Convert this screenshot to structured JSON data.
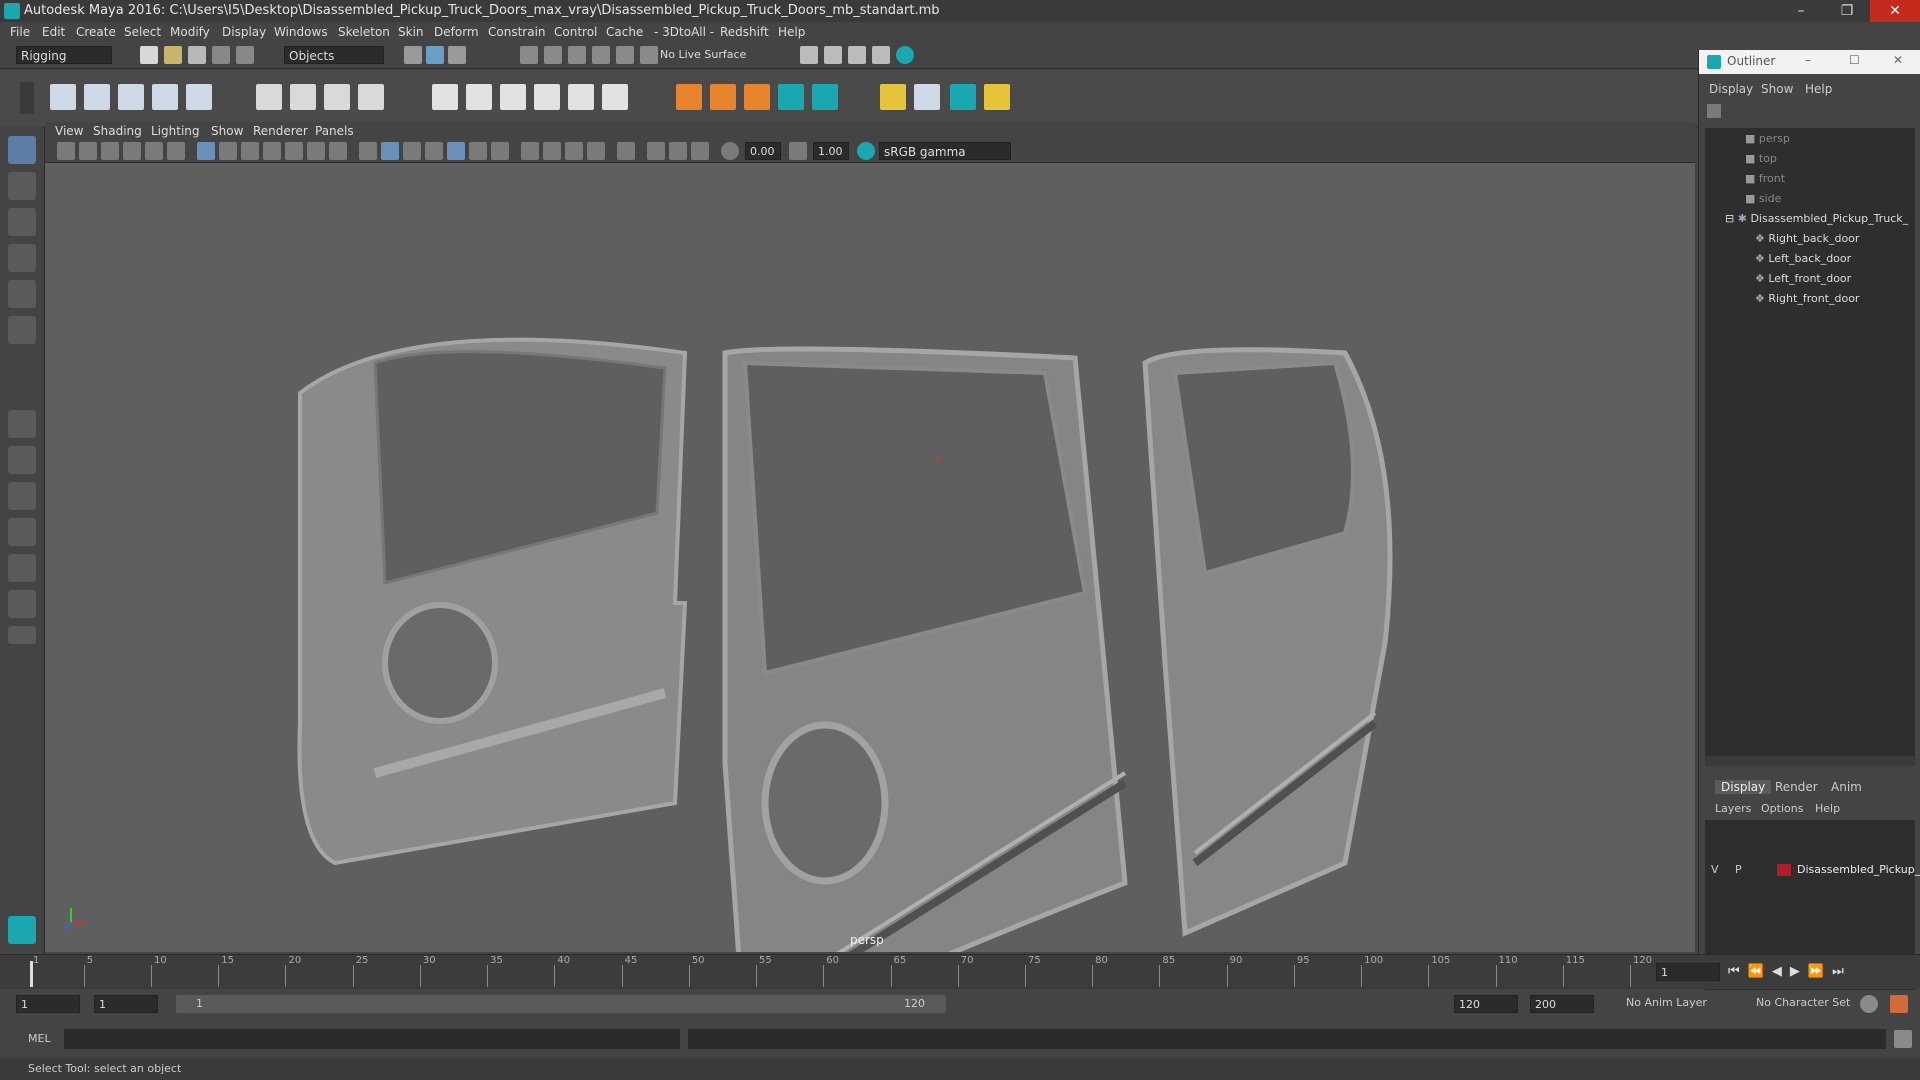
{
  "window": {
    "title": "Autodesk Maya 2016: C:\\Users\\I5\\Desktop\\Disassembled_Pickup_Truck_Doors_max_vray\\Disassembled_Pickup_Truck_Doors_mb_standart.mb",
    "min": "–",
    "restore": "❐",
    "close": "✕"
  },
  "menubar": [
    "File",
    "Edit",
    "Create",
    "Select",
    "Modify",
    "Display",
    "Windows",
    "Skeleton",
    "Skin",
    "Deform",
    "Constrain",
    "Control",
    "Cache",
    "- 3DtoAll -",
    "Redshift",
    "Help"
  ],
  "status_line": {
    "mode": "Rigging",
    "selection": "Objects",
    "live_surface": "No Live Surface"
  },
  "panel": {
    "menus": [
      "View",
      "Shading",
      "Lighting",
      "Show",
      "Renderer",
      "Panels"
    ],
    "exposure": "0.00",
    "gamma": "1.00",
    "color_space": "sRGB gamma",
    "camera": "persp"
  },
  "outliner": {
    "title": "Outliner",
    "menus": [
      "Display",
      "Show",
      "Help"
    ],
    "cameras": [
      "persp",
      "top",
      "front",
      "side"
    ],
    "root": "Disassembled_Pickup_Truck_",
    "children": [
      "Right_back_door",
      "Left_back_door",
      "Left_front_door",
      "Right_front_door"
    ],
    "min": "–",
    "restore": "☐",
    "close": "✕"
  },
  "layer_editor": {
    "tabs": [
      "Display",
      "Render",
      "Anim"
    ],
    "menus": [
      "Layers",
      "Options",
      "Help"
    ],
    "layer": {
      "v": "V",
      "p": "P",
      "name": "Disassembled_Pickup_",
      "color": "#b01e2a"
    }
  },
  "timeline": {
    "ticks": [
      1,
      5,
      10,
      15,
      20,
      25,
      30,
      35,
      40,
      45,
      50,
      55,
      60,
      65,
      70,
      75,
      80,
      85,
      90,
      95,
      100,
      105,
      110,
      115,
      120
    ],
    "current_frame": "1"
  },
  "range": {
    "start": "1",
    "playback_start": "1",
    "slider_start": "1",
    "slider_end": "120",
    "playback_end": "120",
    "end": "200",
    "anim_layer": "No Anim Layer",
    "char_set": "No Character Set"
  },
  "command": {
    "label": "MEL"
  },
  "help": {
    "text": "Select Tool: select an object"
  },
  "colors": {
    "accent": "#1aa7b0",
    "viewport": "#5f5f5f",
    "layer": "#b01e2a"
  }
}
